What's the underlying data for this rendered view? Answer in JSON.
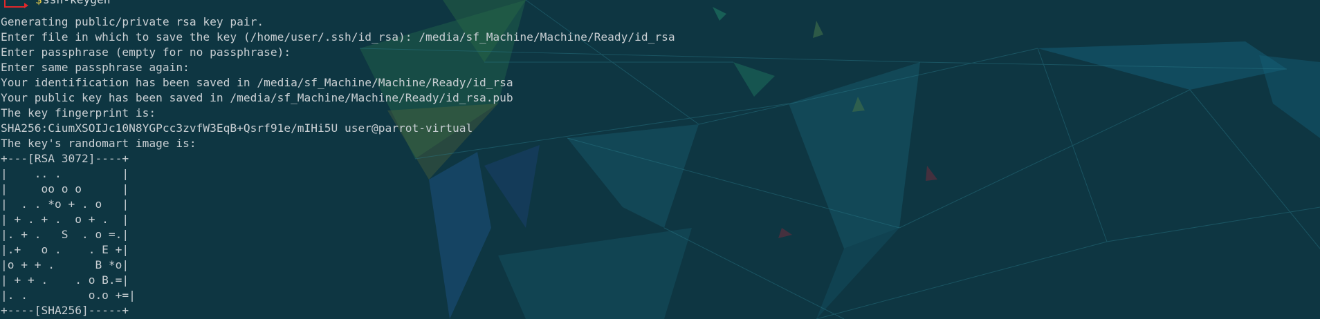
{
  "terminal": {
    "prompt": {
      "symbol": "$",
      "command": "ssh-keygen"
    },
    "output_lines": [
      "Generating public/private rsa key pair.",
      "Enter file in which to save the key (/home/user/.ssh/id_rsa): /media/sf_Machine/Machine/Ready/id_rsa",
      "Enter passphrase (empty for no passphrase):",
      "Enter same passphrase again:",
      "Your identification has been saved in /media/sf_Machine/Machine/Ready/id_rsa",
      "Your public key has been saved in /media/sf_Machine/Machine/Ready/id_rsa.pub",
      "The key fingerprint is:",
      "SHA256:CiumXSOIJc10N8YGPcc3zvfW3EqB+Qsrf91e/mIHi5U user@parrot-virtual",
      "The key's randomart image is:",
      "+---[RSA 3072]----+",
      "|    .. .         |",
      "|     oo o o      |",
      "|  . . *o + . o   |",
      "| + . + .  o + .  |",
      "|. + .   S  . o =.|",
      "|.+   o .    . E +|",
      "|o + + .      B *o|",
      "| + + .    . o B.=|",
      "|. .         o.o +=|",
      "+----[SHA256]-----+"
    ]
  },
  "colors": {
    "background": "#0e3642",
    "text": "#c9cfd3",
    "prompt_symbol": "#f0d24a",
    "prompt_arrow": "#e0282b"
  },
  "icons": {
    "prompt_corner": "prompt-arrow-icon"
  }
}
